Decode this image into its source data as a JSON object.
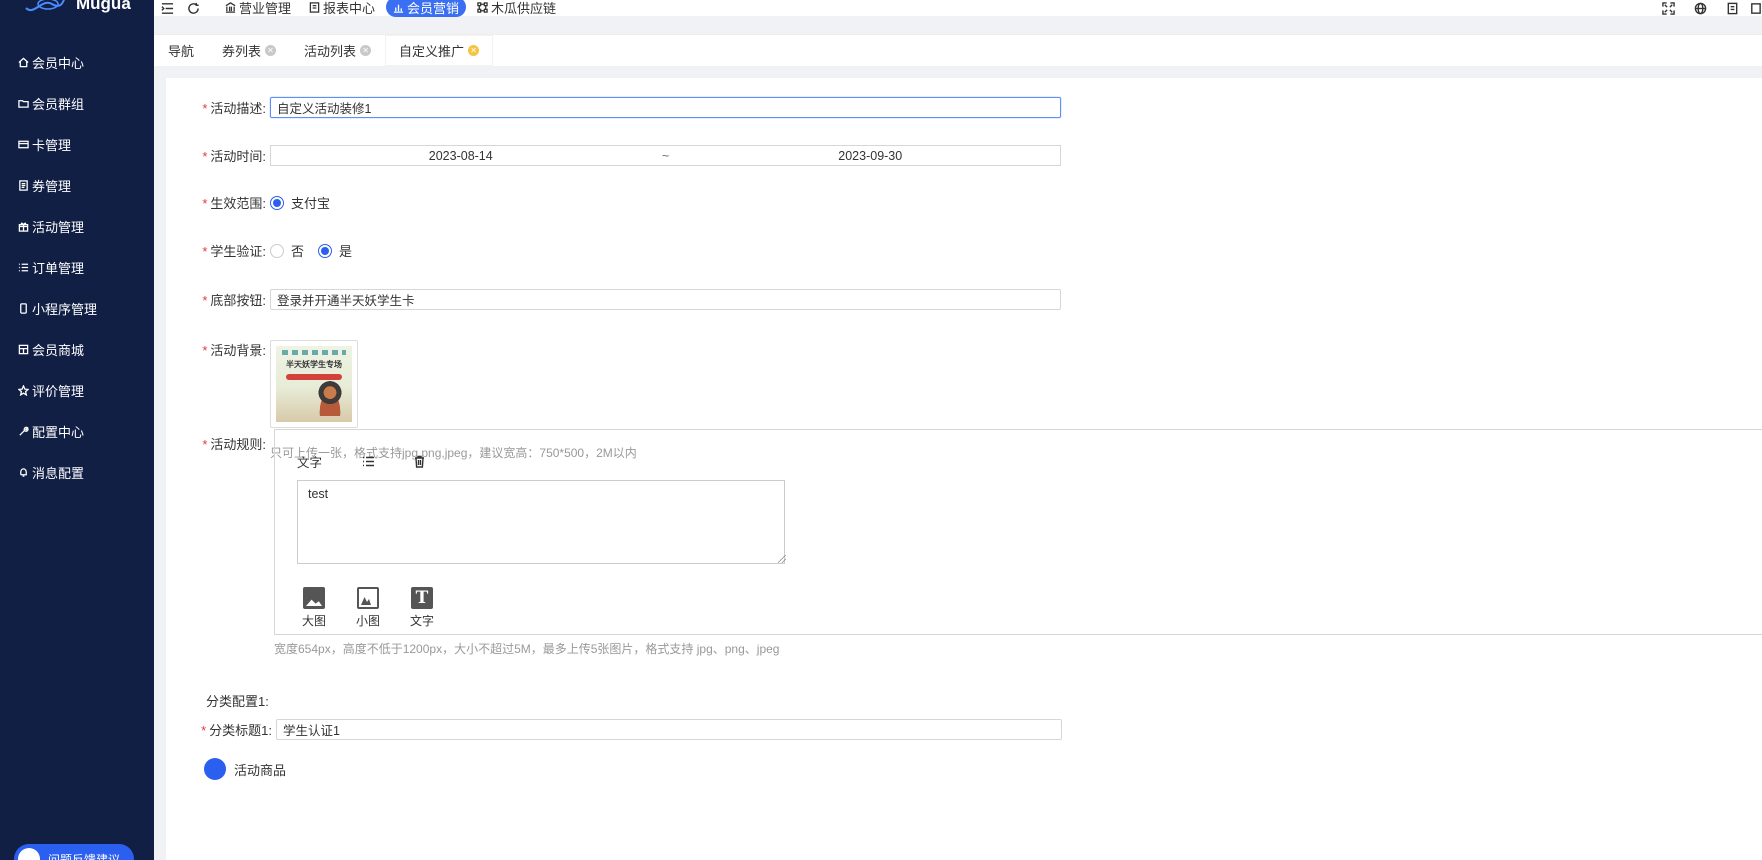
{
  "app": {
    "brand": "Mugua"
  },
  "sidebar": {
    "items": [
      {
        "label": "会员中心",
        "icon": "home-icon"
      },
      {
        "label": "会员群组",
        "icon": "folder-icon"
      },
      {
        "label": "卡管理",
        "icon": "card-icon"
      },
      {
        "label": "券管理",
        "icon": "coupon-icon"
      },
      {
        "label": "活动管理",
        "icon": "gift-icon"
      },
      {
        "label": "订单管理",
        "icon": "list-icon"
      },
      {
        "label": "小程序管理",
        "icon": "mobile-icon"
      },
      {
        "label": "会员商城",
        "icon": "store-icon"
      },
      {
        "label": "评价管理",
        "icon": "star-icon"
      },
      {
        "label": "配置中心",
        "icon": "wrench-icon"
      },
      {
        "label": "消息配置",
        "icon": "bell-icon"
      }
    ],
    "help_label": "问题反馈建议"
  },
  "topbar": {
    "menus": [
      {
        "label": "营业管理",
        "icon": "bank-icon",
        "active": false
      },
      {
        "label": "报表中心",
        "icon": "report-icon",
        "active": false
      },
      {
        "label": "会员营销",
        "icon": "chart-icon",
        "active": true
      },
      {
        "label": "木瓜供应链",
        "icon": "chain-icon",
        "active": false
      }
    ]
  },
  "tabs": [
    {
      "label": "导航",
      "closable": false,
      "active": false
    },
    {
      "label": "券列表",
      "closable": true,
      "active": false
    },
    {
      "label": "活动列表",
      "closable": true,
      "active": false
    },
    {
      "label": "自定义推广",
      "closable": true,
      "active": true
    }
  ],
  "form": {
    "desc": {
      "label": "活动描述:",
      "value": "自定义活动装修1"
    },
    "time": {
      "label": "活动时间:",
      "start": "2023-08-14",
      "sep": "~",
      "end": "2023-09-30"
    },
    "scope": {
      "label": "生效范围:",
      "option": "支付宝"
    },
    "student": {
      "label": "学生验证:",
      "no": "否",
      "yes": "是",
      "selected": "是"
    },
    "bottom_btn": {
      "label": "底部按钮:",
      "value": "登录并开通半天妖学生卡"
    },
    "bg": {
      "label": "活动背景:",
      "hint": "只可上传一张，格式支持jpg,png,jpeg，建议宽高：750*500，2M以内",
      "thumb_title": "半天妖学生专场"
    },
    "rules": {
      "label": "活动规则:",
      "toolbar_text": "文字",
      "textarea": "test",
      "tools": [
        "大图",
        "小图",
        "文字"
      ],
      "hint": "宽度654px，高度不低于1200px，大小不超过5M，最多上传5张图片，格式支持 jpg、png、jpeg"
    },
    "category": {
      "heading": "分类配置1:",
      "title_label": "分类标题1:",
      "title_value": "学生认证1",
      "next_label": "活动商品"
    }
  },
  "colors": {
    "sidebar_bg": "#121f45",
    "accent": "#2b5ff0",
    "required": "#e53935"
  }
}
